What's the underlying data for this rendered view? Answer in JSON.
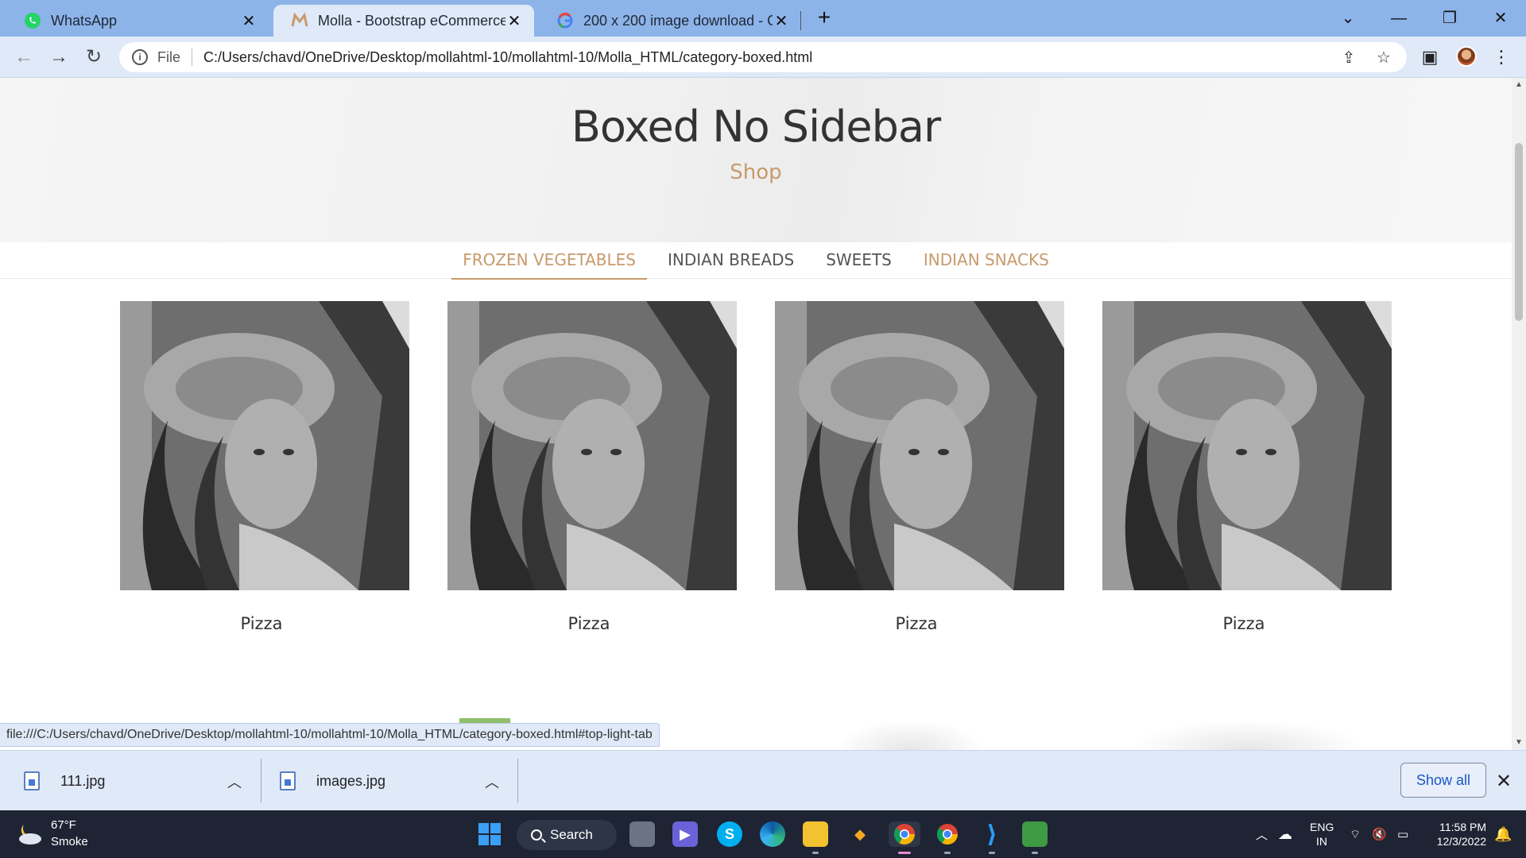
{
  "browser": {
    "tabs": [
      {
        "title": "WhatsApp",
        "icon": "whatsapp-icon"
      },
      {
        "title": "Molla - Bootstrap eCommerce Te",
        "icon": "molla-icon"
      },
      {
        "title": "200 x 200 image download - Goo",
        "icon": "google-icon"
      }
    ],
    "address_label": "File",
    "url": "C:/Users/chavd/OneDrive/Desktop/mollahtml-10/mollahtml-10/Molla_HTML/category-boxed.html"
  },
  "page": {
    "title": "Boxed No Sidebar",
    "subtitle": "Shop",
    "category_tabs": [
      {
        "label": "FROZEN VEGETABLES"
      },
      {
        "label": "INDIAN BREADS"
      },
      {
        "label": "SWEETS"
      },
      {
        "label": "INDIAN SNACKS"
      }
    ],
    "products": [
      {
        "name": "Pizza"
      },
      {
        "name": "Pizza"
      },
      {
        "name": "Pizza"
      },
      {
        "name": "Pizza"
      }
    ],
    "colors": {
      "accent": "#c89a6c",
      "text": "#333333"
    }
  },
  "status_bar": {
    "link": "file:///C:/Users/chavd/OneDrive/Desktop/mollahtml-10/mollahtml-10/Molla_HTML/category-boxed.html#top-light-tab"
  },
  "downloads": {
    "items": [
      {
        "name": "111.jpg"
      },
      {
        "name": "images.jpg"
      }
    ],
    "show_all_label": "Show all"
  },
  "taskbar": {
    "weather_temp": "67°F",
    "weather_desc": "Smoke",
    "search_label": "Search",
    "lang_line1": "ENG",
    "lang_line2": "IN",
    "time": "11:58 PM",
    "date": "12/3/2022"
  }
}
